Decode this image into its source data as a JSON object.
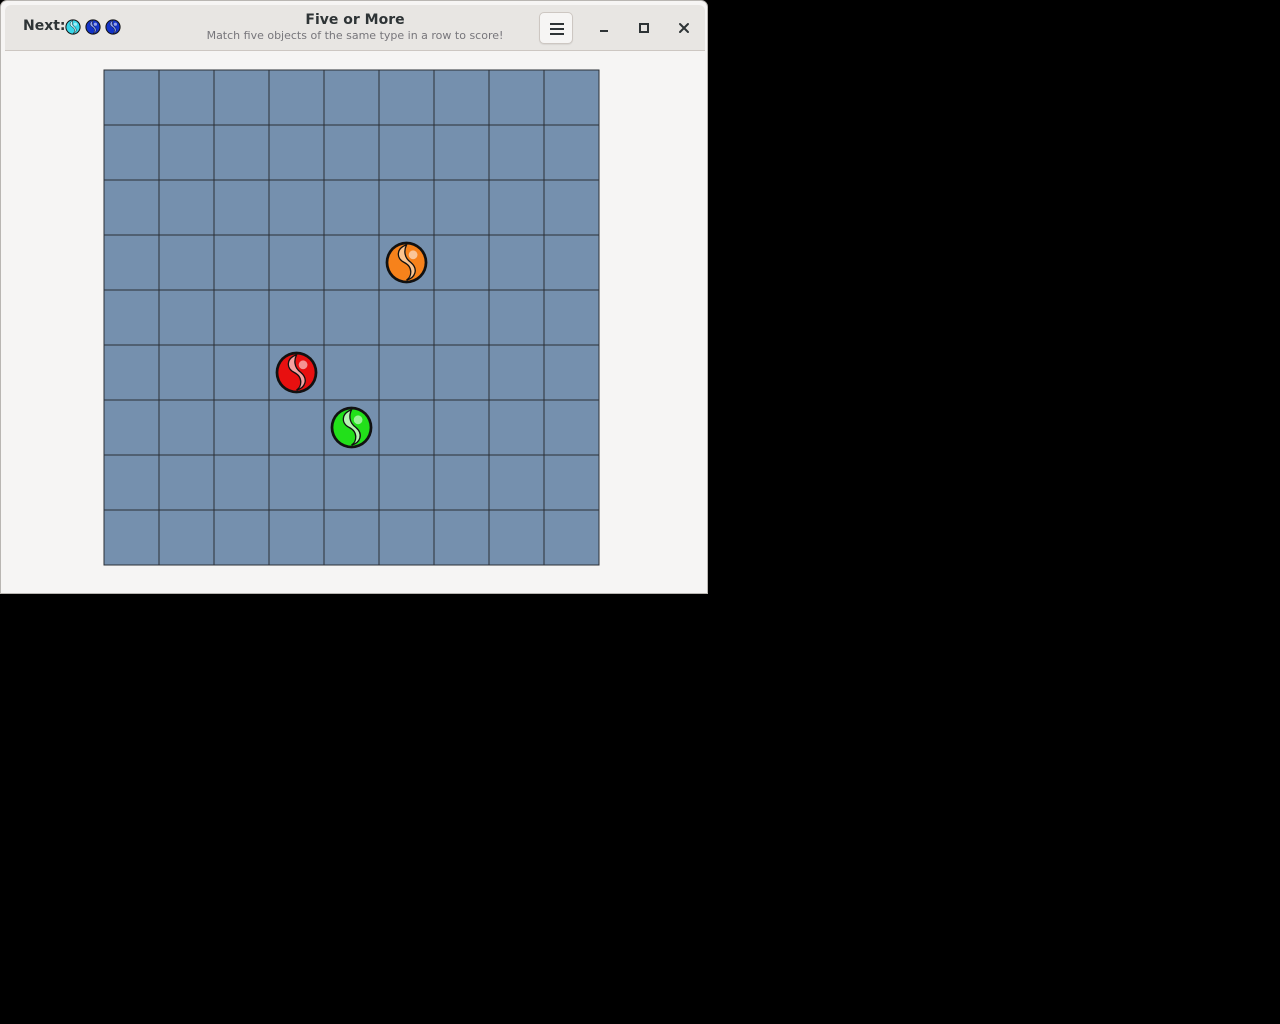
{
  "window": {
    "title": "Five or More",
    "subtitle": "Match five objects of the same type in a row to score!"
  },
  "header": {
    "next_label": "Next:",
    "next_balls": [
      "cyan",
      "blue",
      "blue"
    ]
  },
  "controls": {
    "menu_icon": "hamburger-menu-icon",
    "minimize_icon": "minimize-icon",
    "maximize_icon": "maximize-icon",
    "close_icon": "close-icon"
  },
  "board": {
    "columns": 9,
    "rows": 9,
    "cell_color": "#7590ae",
    "grid_line_color": "#2a2f36",
    "balls": [
      {
        "row": 3,
        "col": 5,
        "color": "orange"
      },
      {
        "row": 5,
        "col": 3,
        "color": "red"
      },
      {
        "row": 6,
        "col": 4,
        "color": "green"
      }
    ]
  },
  "colors": {
    "orange": {
      "base": "#f7821b",
      "light": "#fcc48f"
    },
    "red": {
      "base": "#e81010",
      "light": "#f6a2a2"
    },
    "green": {
      "base": "#22e01a",
      "light": "#b7f5b2"
    },
    "cyan": {
      "base": "#38d6e8",
      "light": "#c0f3f9"
    },
    "blue": {
      "base": "#1433c8",
      "light": "#8aa0f0"
    }
  }
}
